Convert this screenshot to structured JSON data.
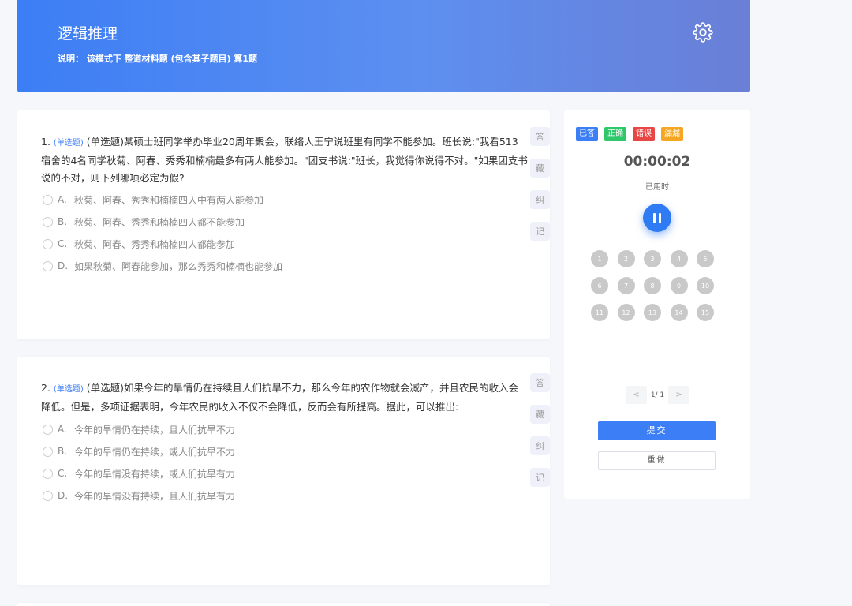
{
  "header": {
    "title": "逻辑推理",
    "description": "说明： 该模式下 整道材料题 (包含其子题目) 算1题",
    "settings_icon": "gear-icon"
  },
  "questions": [
    {
      "number": "1.",
      "type_tag": "(单选题)",
      "stem": "(单选题)某硕士班同学举办毕业20周年聚会，联络人王宁说班里有同学不能参加。班长说:\"我看513宿舍的4名同学秋菊、阿春、秀秀和楠楠最多有两人能参加。\"团支书说:\"班长，我觉得你说得不对。\"如果团支书说的不对，则下列哪项必定为假?",
      "options": [
        {
          "letter": "A.",
          "text": "秋菊、阿春、秀秀和楠楠四人中有两人能参加"
        },
        {
          "letter": "B.",
          "text": "秋菊、阿春、秀秀和楠楠四人都不能参加"
        },
        {
          "letter": "C.",
          "text": "秋菊、阿春、秀秀和楠楠四人都能参加"
        },
        {
          "letter": "D.",
          "text": "如果秋菊、阿春能参加，那么秀秀和楠楠也能参加"
        }
      ],
      "side_tabs": [
        "答",
        "藏",
        "纠",
        "记"
      ]
    },
    {
      "number": "2.",
      "type_tag": "(单选题)",
      "stem": "(单选题)如果今年的旱情仍在持续且人们抗旱不力，那么今年的农作物就会减产，并且农民的收入会降低。但是，多项证据表明，今年农民的收入不仅不会降低，反而会有所提高。据此，可以推出:",
      "options": [
        {
          "letter": "A.",
          "text": "今年的旱情仍在持续，且人们抗旱不力"
        },
        {
          "letter": "B.",
          "text": "今年的旱情仍在持续，或人们抗旱不力"
        },
        {
          "letter": "C.",
          "text": "今年的旱情没有持续，或人们抗旱有力"
        },
        {
          "letter": "D.",
          "text": "今年的旱情没有持续，且人们抗旱有力"
        }
      ],
      "side_tabs": [
        "答",
        "藏",
        "纠",
        "记"
      ]
    }
  ],
  "panel": {
    "legend": [
      "已答",
      "正确",
      "错误",
      "漏漏"
    ],
    "timer": "00:00:02",
    "timer_label": "已用时",
    "pause_icon": "pause-icon",
    "numbers": [
      "1",
      "2",
      "3",
      "4",
      "5",
      "6",
      "7",
      "8",
      "9",
      "10",
      "11",
      "12",
      "13",
      "14",
      "15"
    ],
    "pager": {
      "prev": "<",
      "info": "1/ 1",
      "next": ">"
    },
    "submit_label": "提交",
    "redo_label": "重做",
    "colors": {
      "answered": "#3c7ef5",
      "correct": "#2fc76b",
      "wrong": "#e84545",
      "missed": "#f5a623"
    }
  }
}
